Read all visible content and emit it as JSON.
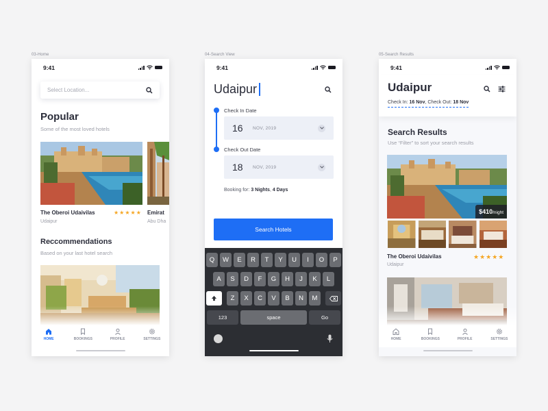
{
  "screens": {
    "home": {
      "frame_label": "03-Home",
      "time": "9:41",
      "search_placeholder": "Select Location...",
      "popular_title": "Popular",
      "popular_subtitle": "Some of the most loved hotels",
      "hotels": [
        {
          "name": "The Oberoi Udaivilas",
          "location": "Udaipur",
          "rating": "★★★★★"
        },
        {
          "name": "Emirat",
          "location": "Abu Dha"
        }
      ],
      "recommendations_title": "Reccommendations",
      "recommendations_subtitle": "Based on your last hotel search",
      "tabs": [
        {
          "label": "HOME",
          "icon": "home-icon",
          "active": true
        },
        {
          "label": "BOOKINGS",
          "icon": "bookmark-icon"
        },
        {
          "label": "PROFILE",
          "icon": "user-icon"
        },
        {
          "label": "SETTINGS",
          "icon": "gear-icon"
        }
      ]
    },
    "search": {
      "frame_label": "04-Search View",
      "time": "9:41",
      "city": "Udaipur",
      "check_in_label": "Check In Date",
      "check_in_day": "16",
      "check_in_month": "NOV, 2019",
      "check_out_label": "Check Out Date",
      "check_out_day": "18",
      "check_out_month": "NOV, 2019",
      "booking_prefix": "Booking for: ",
      "booking_nights": "3 Nights",
      "booking_sep": ", ",
      "booking_days": "4 Days",
      "search_button": "Search Hotels",
      "keyboard": {
        "row1": [
          "Q",
          "W",
          "E",
          "R",
          "T",
          "Y",
          "U",
          "I",
          "O",
          "P"
        ],
        "row2": [
          "A",
          "S",
          "D",
          "F",
          "G",
          "H",
          "J",
          "K",
          "L"
        ],
        "row3": [
          "Z",
          "X",
          "C",
          "V",
          "B",
          "N",
          "M"
        ],
        "numbers": "123",
        "space": "space",
        "go": "Go"
      }
    },
    "results": {
      "frame_label": "05-Search Results",
      "time": "9:41",
      "city": "Udaipur",
      "check_in_prefix": "Check In: ",
      "check_in": "16 Nov",
      "check_out_prefix": ", Check Out: ",
      "check_out": "18 Nov",
      "title": "Search Results",
      "subtitle": "Use “Filter” to sort your search results",
      "price": "$410",
      "price_unit": "/night",
      "hotel_name": "The Oberoi Udaivilas",
      "hotel_location": "Udaipur",
      "rating": "★★★★★",
      "tabs": [
        {
          "label": "HOME",
          "icon": "home-icon"
        },
        {
          "label": "BOOKINGS",
          "icon": "bookmark-icon"
        },
        {
          "label": "PROFILE",
          "icon": "user-icon"
        },
        {
          "label": "SETTINGS",
          "icon": "gear-icon"
        }
      ]
    }
  },
  "colors": {
    "accent": "#1e6ef5",
    "star": "#f5a623",
    "text": "#2b2d3a",
    "muted": "#9b9da7"
  }
}
